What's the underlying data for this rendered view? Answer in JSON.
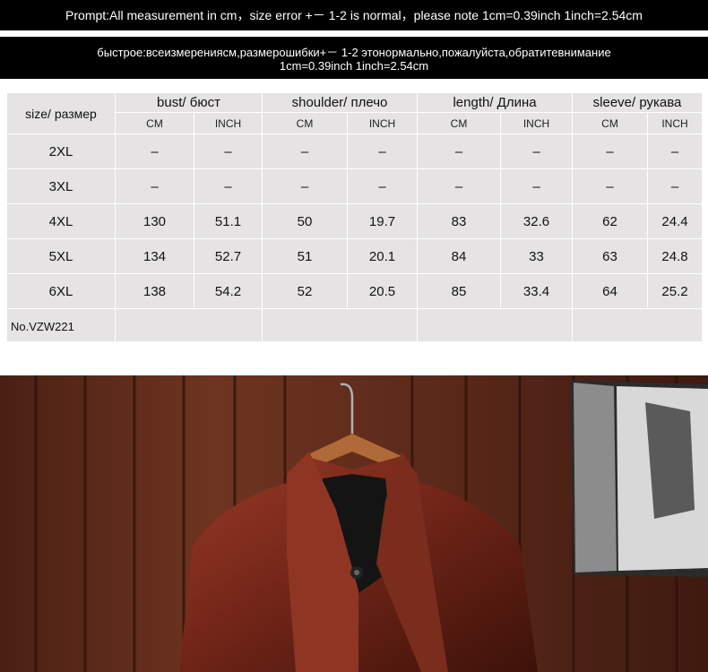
{
  "banner1": {
    "text": "Prompt:All measurement in cm，size error +－ 1-2 is normal，please note 1cm=0.39inch   1inch=2.54cm"
  },
  "banner2": {
    "line1": "быстрое:всеизмерениясм,размерошибки+－ 1-2 этонормально,пожалуйста,обратитевнимание",
    "line2": "1cm=0.39inch   1inch=2.54cm"
  },
  "table": {
    "size_header": "size/ размер",
    "groups": [
      {
        "label": "bust/ бюст"
      },
      {
        "label": "shoulder/ плечо"
      },
      {
        "label": "length/ Длина"
      },
      {
        "label": "sleeve/ рукава"
      }
    ],
    "unit_cm": "CM",
    "unit_inch": "INCH",
    "rows": [
      {
        "size": "2XL",
        "v": [
          "–",
          "–",
          "–",
          "–",
          "–",
          "–",
          "–",
          "–"
        ]
      },
      {
        "size": "3XL",
        "v": [
          "–",
          "–",
          "–",
          "–",
          "–",
          "–",
          "–",
          "–"
        ]
      },
      {
        "size": "4XL",
        "v": [
          "130",
          "51.1",
          "50",
          "19.7",
          "83",
          "32.6",
          "62",
          "24.4"
        ]
      },
      {
        "size": "5XL",
        "v": [
          "134",
          "52.7",
          "51",
          "20.1",
          "84",
          "33",
          "63",
          "24.8"
        ]
      },
      {
        "size": "6XL",
        "v": [
          "138",
          "54.2",
          "52",
          "20.5",
          "85",
          "33.4",
          "64",
          "25.2"
        ]
      }
    ],
    "model_no": "No.VZW221"
  },
  "colors": {
    "banner_bg": "#000000",
    "table_bg": "#e5e3e3",
    "wood": "#6b3220",
    "leather": "#7a2a1c"
  }
}
